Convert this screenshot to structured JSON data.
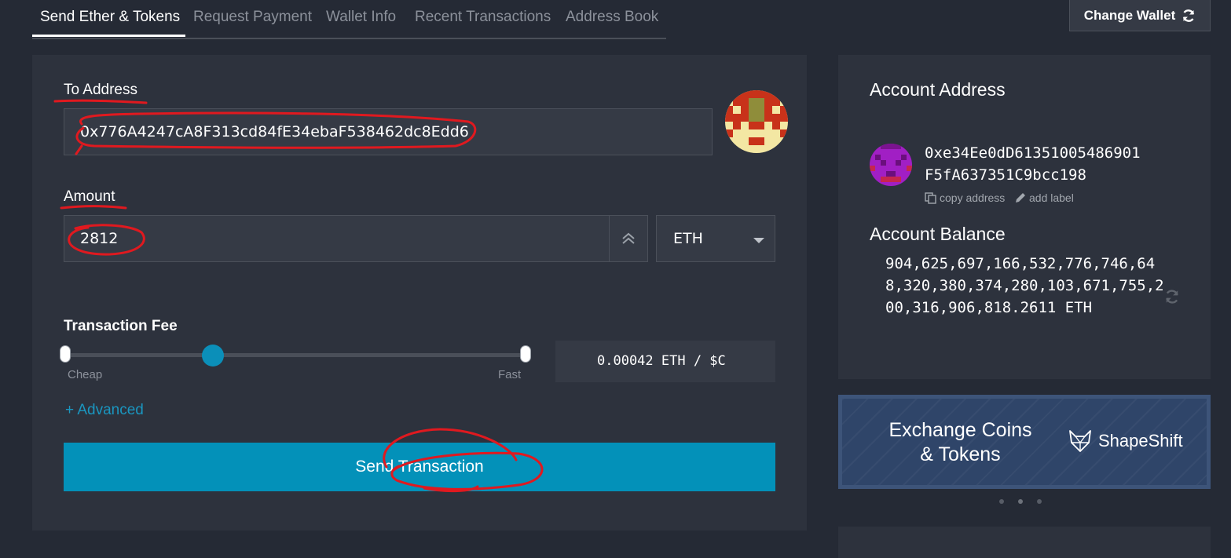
{
  "tabs": [
    {
      "label": "Send Ether & Tokens",
      "active": true
    },
    {
      "label": "Request Payment"
    },
    {
      "label": "Wallet Info"
    },
    {
      "label": "Recent Transactions"
    },
    {
      "label": "Address Book"
    }
  ],
  "header": {
    "change_wallet_label": "Change Wallet",
    "change_wallet_icon": "refresh-icon"
  },
  "send_form": {
    "to_address_label": "To Address",
    "to_address_value": "0x776A4247cA8F313cd84fE34ebaF538462dc8Edd6",
    "amount_label": "Amount",
    "amount_value": "2812",
    "unit_button_icon": "double-chevron-up-icon",
    "currency_selected": "ETH",
    "fee_label": "Transaction Fee",
    "fee_cheap_label": "Cheap",
    "fee_fast_label": "Fast",
    "fee_level": 0.32,
    "fee_value": "0.00042 ETH / $C",
    "advanced_label": "+ Advanced",
    "send_button_label": "Send Transaction"
  },
  "account": {
    "address_title": "Account Address",
    "address_line1": "0xe34Ee0dD61351005486901",
    "address_line2": "F5fA637351C9bcc198",
    "copy_label": "copy address",
    "add_label": "add label",
    "balance_title": "Account Balance",
    "balance_value": "904,625,697,166,532,776,746,648,320,380,374,280,103,671,755,200,316,906,818.2611 ETH"
  },
  "banner": {
    "text_line1": "Exchange Coins",
    "text_line2": "& Tokens",
    "brand": "ShapeShift"
  },
  "colors": {
    "accent": "#0391b9",
    "background": "#252a35",
    "panel": "#2d323d",
    "annotation": "#e0191f"
  }
}
